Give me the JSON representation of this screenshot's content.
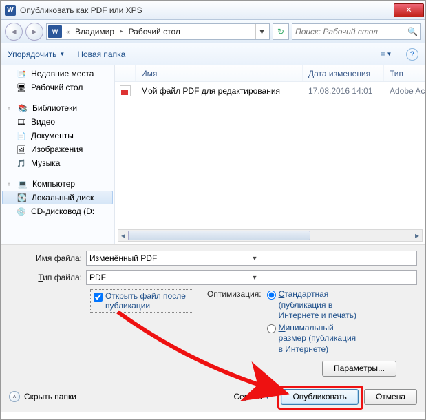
{
  "window": {
    "title": "Опубликовать как PDF или XPS",
    "app_letter": "W"
  },
  "nav": {
    "word_badge": "W",
    "sep": "«",
    "crumb1": "Владимир",
    "crumb2": "Рабочий стол",
    "search_placeholder": "Поиск: Рабочий стол"
  },
  "toolbar": {
    "organize": "Упорядочить",
    "new_folder": "Новая папка"
  },
  "sidebar": {
    "recent": "Недавние места",
    "desktop": "Рабочий стол",
    "libraries": "Библиотеки",
    "video": "Видео",
    "documents": "Документы",
    "pictures": "Изображения",
    "music": "Музыка",
    "computer": "Компьютер",
    "local_disk": "Локальный диск",
    "cd_drive": "CD-дисковод (D:"
  },
  "filelist": {
    "col_name": "Имя",
    "col_date": "Дата изменения",
    "col_type": "Тип",
    "row1_name": "Мой файл PDF для редактирования",
    "row1_date": "17.08.2016 14:01",
    "row1_type": "Adobe Ac"
  },
  "form": {
    "filename_label_pre": "Имя файла:",
    "filename_value": "Изменённый PDF",
    "filetype_label_pre": "Тип файла:",
    "filetype_value": "PDF",
    "open_after_label": "Открыть файл после публикации",
    "optimization_label": "Оптимизация:",
    "radio_standard": "Стандартная (публикация в Интернете и печать)",
    "radio_min": "Минимальный размер (публикация в Интернете)",
    "params_btn": "Параметры...",
    "hide_folders": "Скрыть папки",
    "service": "Сервис",
    "publish_btn": "Опубликовать",
    "cancel_btn": "Отмена"
  }
}
